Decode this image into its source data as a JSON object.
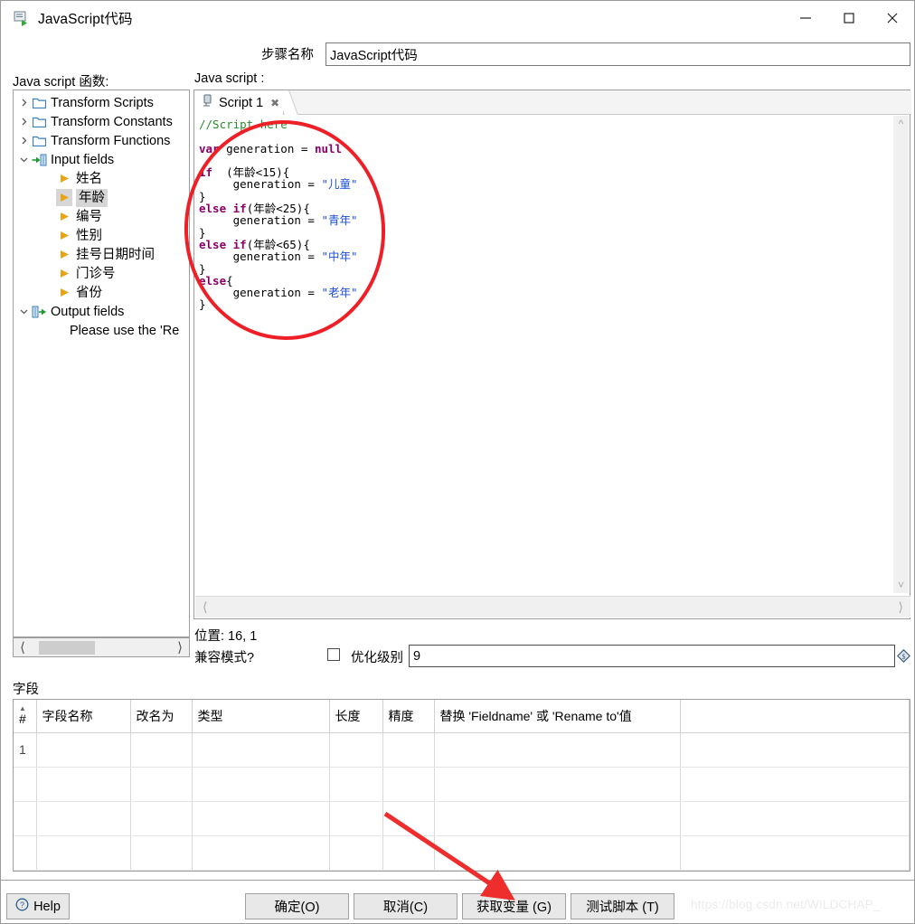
{
  "window": {
    "title": "JavaScript代码",
    "icon": "script-step-icon",
    "controls": {
      "minimize": "–",
      "maximize": "□",
      "close": "✕"
    }
  },
  "step": {
    "label": "步骤名称",
    "value": "JavaScript代码"
  },
  "panels": {
    "functions_label": "Java script 函数:",
    "script_label": "Java script :"
  },
  "tree": {
    "nodes": [
      {
        "label": "Transform Scripts",
        "icon": "folder-icon",
        "twisty": "collapsed",
        "level": 0,
        "selected": false
      },
      {
        "label": "Transform Constants",
        "icon": "folder-icon",
        "twisty": "collapsed",
        "level": 0,
        "selected": false
      },
      {
        "label": "Transform Functions",
        "icon": "folder-icon",
        "twisty": "collapsed",
        "level": 0,
        "selected": false
      },
      {
        "label": "Input fields",
        "icon": "input-fields-icon",
        "twisty": "expanded",
        "level": 0,
        "selected": false
      },
      {
        "label": "姓名",
        "icon": "field-arrow-icon",
        "twisty": "none",
        "level": 1,
        "selected": false
      },
      {
        "label": "年龄",
        "icon": "field-arrow-icon",
        "twisty": "none",
        "level": 1,
        "selected": true
      },
      {
        "label": "编号",
        "icon": "field-arrow-icon",
        "twisty": "none",
        "level": 1,
        "selected": false
      },
      {
        "label": "性别",
        "icon": "field-arrow-icon",
        "twisty": "none",
        "level": 1,
        "selected": false
      },
      {
        "label": "挂号日期时间",
        "icon": "field-arrow-icon",
        "twisty": "none",
        "level": 1,
        "selected": false
      },
      {
        "label": "门诊号",
        "icon": "field-arrow-icon",
        "twisty": "none",
        "level": 1,
        "selected": false
      },
      {
        "label": "省份",
        "icon": "field-arrow-icon",
        "twisty": "none",
        "level": 1,
        "selected": false
      },
      {
        "label": "Output fields",
        "icon": "output-fields-icon",
        "twisty": "expanded",
        "level": 0,
        "selected": false
      },
      {
        "label": "Please use the 'Re",
        "icon": "none",
        "twisty": "none",
        "level": 2,
        "selected": false
      }
    ]
  },
  "editor": {
    "tab_label": "Script 1",
    "tab_icon": "script-tab-icon",
    "tab_close": "✕",
    "code_lines": [
      [
        {
          "t": "//Script here",
          "c": "comment"
        }
      ],
      [],
      [
        {
          "t": "var",
          "c": "kw"
        },
        {
          "t": " generation = ",
          "c": "plain"
        },
        {
          "t": "null",
          "c": "kw"
        }
      ],
      [],
      [
        {
          "t": "if",
          "c": "kw"
        },
        {
          "t": "  (年龄<15){",
          "c": "plain"
        }
      ],
      [
        {
          "t": "     generation = ",
          "c": "plain"
        },
        {
          "t": "\"儿童\"",
          "c": "str"
        }
      ],
      [
        {
          "t": "}",
          "c": "plain"
        }
      ],
      [
        {
          "t": "else if",
          "c": "kw"
        },
        {
          "t": "(年龄<25){",
          "c": "plain"
        }
      ],
      [
        {
          "t": "     generation = ",
          "c": "plain"
        },
        {
          "t": "\"青年\"",
          "c": "str"
        }
      ],
      [
        {
          "t": "}",
          "c": "plain"
        }
      ],
      [
        {
          "t": "else if",
          "c": "kw"
        },
        {
          "t": "(年龄<65){",
          "c": "plain"
        }
      ],
      [
        {
          "t": "     generation = ",
          "c": "plain"
        },
        {
          "t": "\"中年\"",
          "c": "str"
        }
      ],
      [
        {
          "t": "}",
          "c": "plain"
        }
      ],
      [
        {
          "t": "else",
          "c": "kw"
        },
        {
          "t": "{",
          "c": "plain"
        }
      ],
      [
        {
          "t": "     generation = ",
          "c": "plain"
        },
        {
          "t": "\"老年\"",
          "c": "str"
        }
      ],
      [
        {
          "t": "}",
          "c": "plain"
        }
      ]
    ]
  },
  "status": {
    "position_text": "位置: 16, 1",
    "compat_label": "兼容模式?",
    "compat_checked": false,
    "optimization_label": "优化级别",
    "optimization_value": "9",
    "variable_icon": "variable-diamond-icon"
  },
  "fields": {
    "section_label": "字段",
    "columns": [
      "#",
      "字段名称",
      "改名为",
      "类型",
      "长度",
      "精度",
      "替换 'Fieldname' 或 'Rename to'值",
      ""
    ],
    "rows": [
      {
        "num": "1",
        "name": "",
        "rename": "",
        "type": "",
        "length": "",
        "precision": "",
        "replace": "",
        "extra": ""
      },
      {
        "num": "",
        "name": "",
        "rename": "",
        "type": "",
        "length": "",
        "precision": "",
        "replace": "",
        "extra": ""
      },
      {
        "num": "",
        "name": "",
        "rename": "",
        "type": "",
        "length": "",
        "precision": "",
        "replace": "",
        "extra": ""
      },
      {
        "num": "",
        "name": "",
        "rename": "",
        "type": "",
        "length": "",
        "precision": "",
        "replace": "",
        "extra": ""
      }
    ]
  },
  "buttons": {
    "help": "Help",
    "ok": "确定(O)",
    "cancel": "取消(C)",
    "get_variables": "获取变量 (G)",
    "test_script": "测试脚本 (T)"
  },
  "watermark": "https://blog.csdn.net/WILDCHAP_",
  "annotations": {
    "ellipse_color": "#ee1f26",
    "arrow_color": "#ee2d2d"
  },
  "colors": {
    "comment": "#2a8a2a",
    "keyword": "#8b0068",
    "string": "#1c4fd8",
    "selection": "#d6d6d6"
  }
}
